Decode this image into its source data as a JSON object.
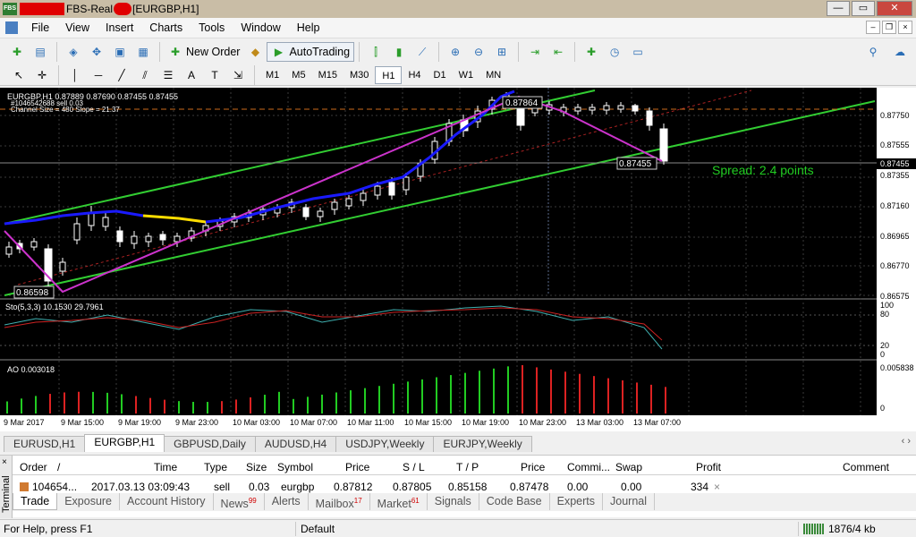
{
  "window": {
    "app_icon_text": "FBS",
    "title_mid": "FBS-Real",
    "title_tail": "[EURGBP,H1]",
    "controls": [
      "—",
      "▭",
      "✕"
    ]
  },
  "menu": {
    "items": [
      "File",
      "View",
      "Insert",
      "Charts",
      "Tools",
      "Window",
      "Help"
    ]
  },
  "toolbar": {
    "new_order": "New Order",
    "auto_trading": "AutoTrading"
  },
  "timeframes": [
    "M1",
    "M5",
    "M15",
    "M30",
    "H1",
    "H4",
    "D1",
    "W1",
    "MN"
  ],
  "active_timeframe": "H1",
  "chart": {
    "header_line1": "EURGBP,H1  0.87889 0.87690 0.87455 0.87455",
    "header_line2": "#1046542688 sell 0.03",
    "header_line3": "Channel Size = 480  Slope = 21.37",
    "price_labels": [
      "0.87750",
      "0.87555",
      "0.87455",
      "0.87355",
      "0.87160",
      "0.86965",
      "0.86770",
      "0.86575"
    ],
    "current_price": "0.87455",
    "marker_high": "0.87864",
    "marker_low": "0.86598",
    "marker_current": "0.87455",
    "spread_text": "Spread: 2.4 points",
    "sto_label": "Sto(5,3,3) 10.1530 29.7961",
    "sto_levels": [
      "100",
      "80",
      "20",
      "0"
    ],
    "ao_label": "AO 0.003018",
    "ao_levels": [
      "0.005838",
      "0"
    ],
    "time_labels": [
      "9 Mar 2017",
      "9 Mar 15:00",
      "9 Mar 19:00",
      "9 Mar 23:00",
      "10 Mar 03:00",
      "10 Mar 07:00",
      "10 Mar 11:00",
      "10 Mar 15:00",
      "10 Mar 19:00",
      "10 Mar 23:00",
      "13 Mar 03:00",
      "13 Mar 07:00"
    ],
    "colors": {
      "background": "#000000",
      "bull_candle": "#ffffff",
      "channel": "#32cd32",
      "zigzag": "#cc33cc",
      "ma": "#1a1aff",
      "ma_flat": "#ffdd00",
      "ao_up": "#22cc22",
      "ao_down": "#dd2222",
      "spread": "#22cc22"
    }
  },
  "chart_tabs": [
    "EURUSD,H1",
    "EURGBP,H1",
    "GBPUSD,Daily",
    "AUDUSD,H4",
    "USDJPY,Weekly",
    "EURJPY,Weekly"
  ],
  "active_chart_tab": "EURGBP,H1",
  "terminal": {
    "side_label": "Terminal",
    "columns": [
      "Order",
      "/",
      "Time",
      "Type",
      "Size",
      "Symbol",
      "Price",
      "S / L",
      "T / P",
      "Price",
      "Commi...",
      "Swap",
      "Profit",
      "Comment"
    ],
    "row": {
      "order": "104654...",
      "time": "2017.03.13 03:09:43",
      "type": "sell",
      "size": "0.03",
      "symbol": "eurgbp",
      "price": "0.87812",
      "sl": "0.87805",
      "tp": "0.85158",
      "cur_price": "0.87478",
      "commission": "0.00",
      "swap": "0.00",
      "profit": "334"
    },
    "tabs": [
      {
        "label": "Trade",
        "badge": ""
      },
      {
        "label": "Exposure",
        "badge": ""
      },
      {
        "label": "Account History",
        "badge": ""
      },
      {
        "label": "News",
        "badge": "99"
      },
      {
        "label": "Alerts",
        "badge": ""
      },
      {
        "label": "Mailbox",
        "badge": "17"
      },
      {
        "label": "Market",
        "badge": "61"
      },
      {
        "label": "Signals",
        "badge": ""
      },
      {
        "label": "Code Base",
        "badge": ""
      },
      {
        "label": "Experts",
        "badge": ""
      },
      {
        "label": "Journal",
        "badge": ""
      }
    ]
  },
  "status": {
    "help": "For Help, press F1",
    "profile": "Default",
    "traffic": "1876/4 kb"
  }
}
